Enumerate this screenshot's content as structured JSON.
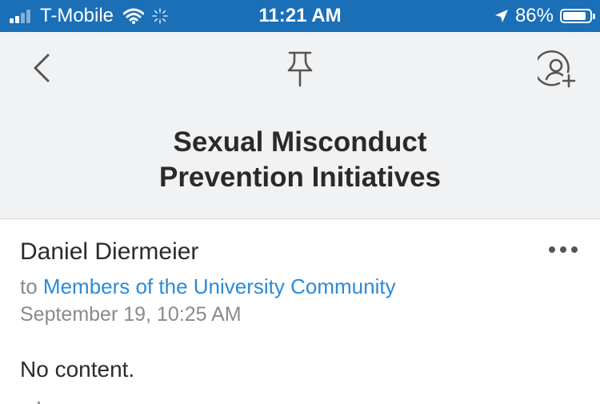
{
  "status_bar": {
    "carrier": "T-Mobile",
    "time": "11:21 AM",
    "battery_percent": "86%",
    "battery_level": 0.86,
    "signal_bars_filled": 2,
    "signal_bars_total": 4,
    "icons": [
      "signal-icon",
      "wifi-icon",
      "loading-icon",
      "location-icon",
      "battery-icon"
    ]
  },
  "nav": {
    "back_icon": "chevron-left-icon",
    "pin_icon": "pin-icon",
    "add_person_icon": "add-person-icon",
    "title_line1": "Sexual Misconduct",
    "title_line2": "Prevention Initiatives"
  },
  "message": {
    "sender": "Daniel Diermeier",
    "to_prefix": "to",
    "recipient": "Members of the University Community",
    "date": "September 19, 10:25 AM",
    "body": "No content.",
    "more_icon": "more-icon"
  },
  "colors": {
    "status_bar": "#1a6fb7",
    "header_bg": "#f1f2f4",
    "link": "#2c8ad6"
  }
}
